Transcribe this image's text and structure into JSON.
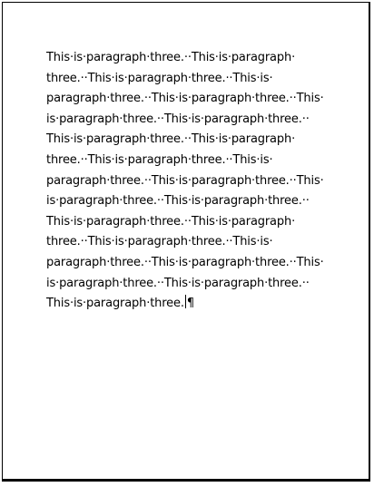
{
  "document": {
    "lines": [
      "This·is·paragraph·three.··This·is·paragraph·",
      "three.··This·is·paragraph·three.··This·is·",
      "paragraph·three.··This·is·paragraph·three.··This·",
      "is·paragraph·three.··This·is·paragraph·three.··",
      "This·is·paragraph·three.··This·is·paragraph·",
      "three.··This·is·paragraph·three.··This·is·",
      "paragraph·three.··This·is·paragraph·three.··This·",
      "is·paragraph·three.··This·is·paragraph·three.··",
      "This·is·paragraph·three.··This·is·paragraph·",
      "three.··This·is·paragraph·three.··This·is·",
      "paragraph·three.··This·is·paragraph·three.··This·",
      "is·paragraph·three.··This·is·paragraph·three.··"
    ],
    "last_line": "This·is·paragraph·three.",
    "pilcrow": "¶"
  }
}
